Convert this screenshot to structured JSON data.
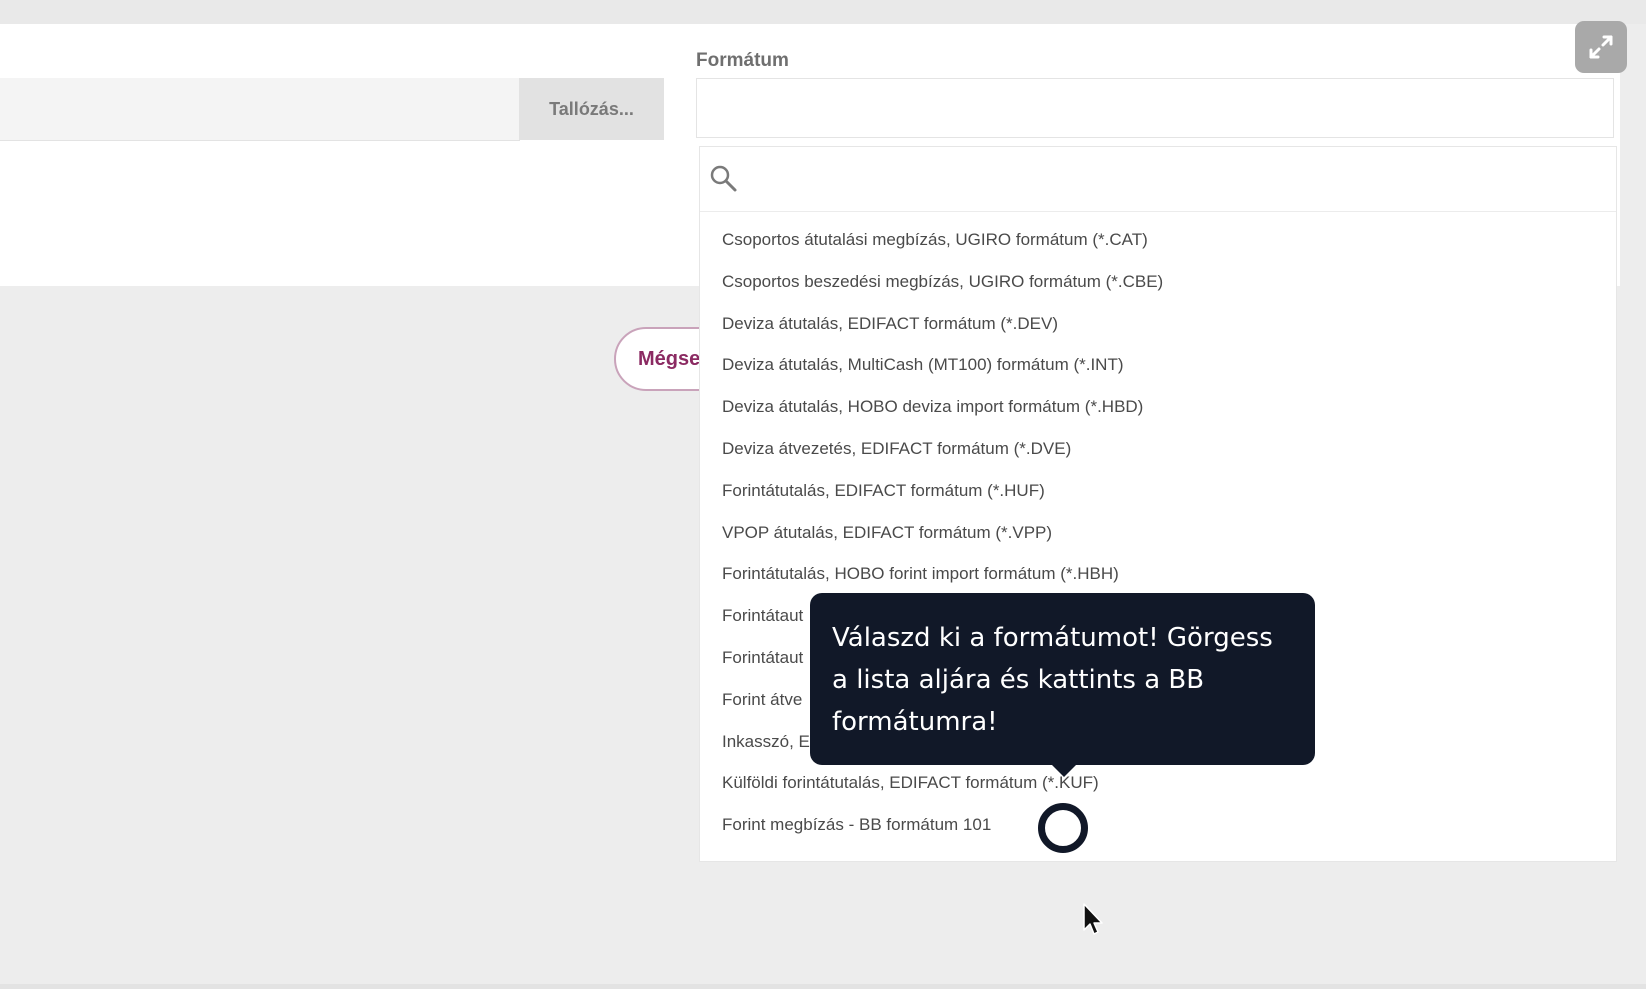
{
  "upload": {
    "browse_label": "Tallózás..."
  },
  "format": {
    "label": "Formátum",
    "selected_value": "",
    "search_placeholder": "",
    "options": [
      "Csoportos átutalási megbízás, UGIRO formátum (*.CAT)",
      "Csoportos beszedési megbízás, UGIRO formátum (*.CBE)",
      "Deviza átutalás, EDIFACT formátum (*.DEV)",
      "Deviza átutalás, MultiCash (MT100) formátum (*.INT)",
      "Deviza átutalás, HOBO deviza import formátum (*.HBD)",
      "Deviza átvezetés, EDIFACT formátum (*.DVE)",
      "Forintátutalás, EDIFACT formátum (*.HUF)",
      "VPOP átutalás, EDIFACT formátum (*.VPP)",
      "Forintátutalás, HOBO forint import formátum (*.HBH)",
      "Forintátaut",
      "Forintátaut",
      "Forint átve",
      "Inkasszó, E",
      "Külföldi forintátutalás, EDIFACT formátum (*.KUF)",
      "Forint megbízás - BB formátum 101"
    ]
  },
  "actions": {
    "cancel_label": "Mégse"
  },
  "tooltip": {
    "text": "Válaszd ki a formátumot! Görgess a lista aljára és kattints a BB formátumra!"
  },
  "colors": {
    "tooltip_bg": "#111828",
    "cancel_text": "#8b2a62",
    "expand_bg": "#a9a9a9"
  },
  "icons": {
    "expand": "expand-arrows-icon",
    "search": "search-icon",
    "cursor": "mouse-pointer-icon"
  }
}
